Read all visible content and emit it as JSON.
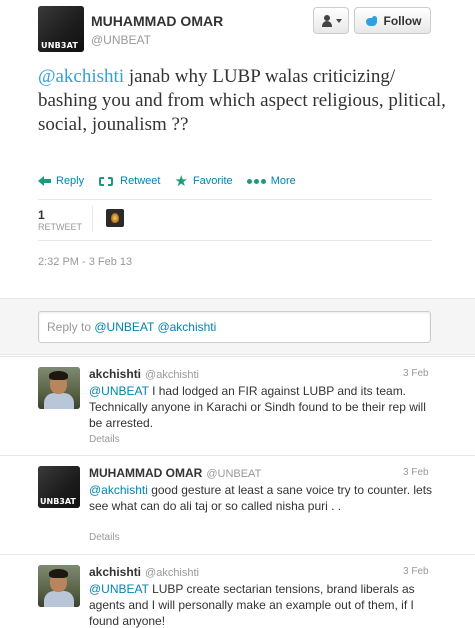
{
  "tweet": {
    "author": {
      "name": "MUHAMMAD OMAR",
      "handle": "@UNBEAT",
      "avatar_text": "UNB3AT"
    },
    "follow_label": "Follow",
    "mention": "@akchishti",
    "body": " janab why LUBP walas criticizing/ bashing you and from which aspect religious, plitical, social, jounalism ??",
    "actions": {
      "reply": "Reply",
      "retweet": "Retweet",
      "favorite": "Favorite",
      "more": "More"
    },
    "stats": {
      "retweet_count": "1",
      "retweet_label": "RETWEET"
    },
    "timestamp": "2:32 PM - 3 Feb 13"
  },
  "reply_box": {
    "prefix": "Reply to ",
    "mentions": "@UNBEAT @akchishti"
  },
  "replies": [
    {
      "name": "akchishti",
      "handle": "@akchishti",
      "time": "3 Feb",
      "mention": "@UNBEAT",
      "text": " I had lodged an FIR against LUBP and its team. Technically anyone in Karachi or Sindh found to be their rep will be arrested.",
      "details": "Details"
    },
    {
      "name": "MUHAMMAD OMAR",
      "handle": "@UNBEAT",
      "time": "3 Feb",
      "mention": "@akchishti",
      "text": " good gesture at least a sane voice try to counter. lets see what can do ali taj or so called nisha puri . .",
      "details": "Details",
      "avatar_text": "UNB3AT"
    },
    {
      "name": "akchishti",
      "handle": "@akchishti",
      "time": "3 Feb",
      "mention": "@UNBEAT",
      "text": " LUBP create sectarian tensions, brand liberals as agents and I will personally make an example out of them, if I found anyone!",
      "details": ""
    }
  ],
  "colors": {
    "link": "#0084b4",
    "mention_main": "#2fa1e0",
    "action_icon": "#1a9b7d",
    "muted": "#999999"
  }
}
